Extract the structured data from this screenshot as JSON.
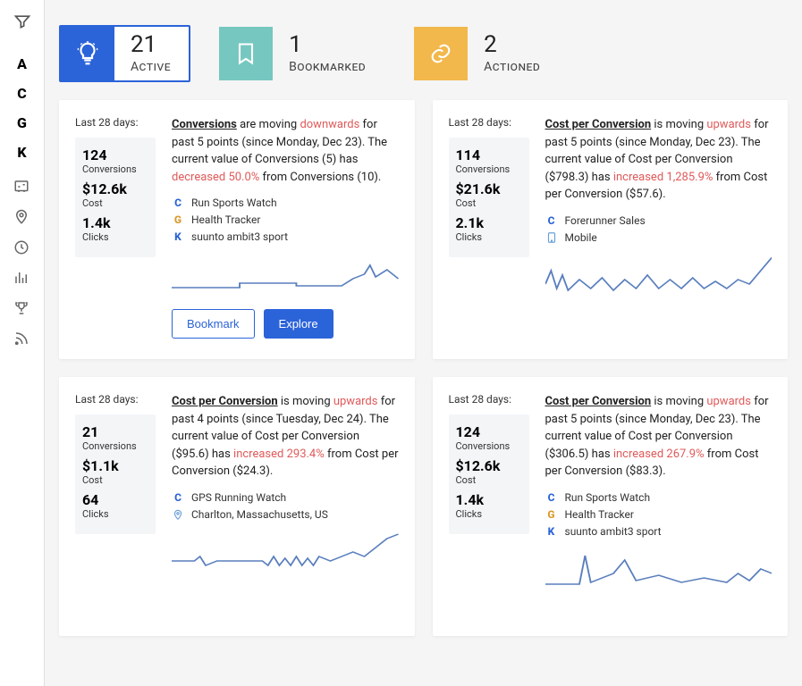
{
  "sidebar": {
    "letters": [
      "A",
      "C",
      "G",
      "K"
    ]
  },
  "tabs": [
    {
      "count": "21",
      "label": "Active",
      "color": "blue",
      "icon": "bulb"
    },
    {
      "count": "1",
      "label": "Bookmarked",
      "color": "teal",
      "icon": "bookmark"
    },
    {
      "count": "2",
      "label": "Actioned",
      "color": "orange",
      "icon": "link"
    }
  ],
  "cards": [
    {
      "period": "Last 28 days:",
      "stats": [
        {
          "value": "124",
          "label": "Conversions"
        },
        {
          "value": "$12.6k",
          "label": "Cost"
        },
        {
          "value": "1.4k",
          "label": "Clicks"
        }
      ],
      "metric": "Conversions",
      "verb": " are moving ",
      "direction": "downwards",
      "tail1": " for past 5 points (since Monday, Dec 23). The current value of Conversions (5) has ",
      "pct": "decreased 50.0%",
      "tail2": " from Conversions (10).",
      "tags": [
        {
          "icon": "C",
          "type": "letter",
          "text": "Run Sports Watch"
        },
        {
          "icon": "G",
          "type": "letter",
          "text": "Health Tracker"
        },
        {
          "icon": "K",
          "type": "letter",
          "text": "suunto ambit3 sport"
        }
      ],
      "spark": "flat-rise",
      "actions": {
        "bookmark": "Bookmark",
        "explore": "Explore"
      }
    },
    {
      "period": "Last 28 days:",
      "stats": [
        {
          "value": "114",
          "label": "Conversions"
        },
        {
          "value": "$21.6k",
          "label": "Cost"
        },
        {
          "value": "2.1k",
          "label": "Clicks"
        }
      ],
      "metric": "Cost per Conversion",
      "verb": " is moving ",
      "direction": "upwards",
      "tail1": " for past 5 points (since Monday, Dec 23). The current value of Cost per Conversion ($798.3) has ",
      "pct": "increased 1,285.9%",
      "tail2": " from Cost per Conversion ($57.6).",
      "tags": [
        {
          "icon": "C",
          "type": "letter",
          "text": "Forerunner Sales"
        },
        {
          "icon": "mobile",
          "type": "svg",
          "text": "Mobile"
        }
      ],
      "spark": "jagged"
    },
    {
      "period": "Last 28 days:",
      "stats": [
        {
          "value": "21",
          "label": "Conversions"
        },
        {
          "value": "$1.1k",
          "label": "Cost"
        },
        {
          "value": "64",
          "label": "Clicks"
        }
      ],
      "metric": "Cost per Conversion",
      "verb": " is moving ",
      "direction": "upwards",
      "tail1": " for past 4 points (since Tuesday, Dec 24). The current value of Cost per Conversion ($95.6) has ",
      "pct": "increased 293.4%",
      "tail2": " from Cost per Conversion ($24.3).",
      "tags": [
        {
          "icon": "C",
          "type": "letter",
          "text": "GPS Running Watch"
        },
        {
          "icon": "pin",
          "type": "svg",
          "text": "Charlton, Massachusetts, US"
        }
      ],
      "spark": "wobble-rise"
    },
    {
      "period": "Last 28 days:",
      "stats": [
        {
          "value": "124",
          "label": "Conversions"
        },
        {
          "value": "$12.6k",
          "label": "Cost"
        },
        {
          "value": "1.4k",
          "label": "Clicks"
        }
      ],
      "metric": "Cost per Conversion",
      "verb": " is moving ",
      "direction": "upwards",
      "tail1": " for past 5 points (since Monday, Dec 23). The current value of Cost per Conversion ($306.5) has ",
      "pct": "increased 267.9%",
      "tail2": " from Cost per Conversion ($83.3).",
      "tags": [
        {
          "icon": "C",
          "type": "letter",
          "text": "Run Sports Watch"
        },
        {
          "icon": "G",
          "type": "letter",
          "text": "Health Tracker"
        },
        {
          "icon": "K",
          "type": "letter",
          "text": "suunto ambit3 sport"
        }
      ],
      "spark": "spike"
    }
  ]
}
